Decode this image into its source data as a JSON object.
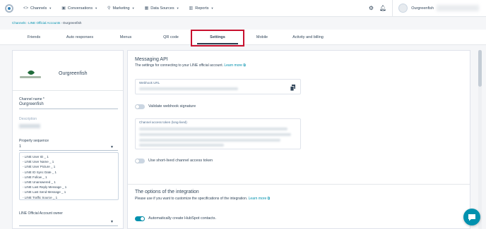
{
  "nav": {
    "items": [
      {
        "label": "Channels",
        "icon": "channels-icon"
      },
      {
        "label": "Conversations",
        "icon": "conversations-icon"
      },
      {
        "label": "Marketing",
        "icon": "marketing-icon"
      },
      {
        "label": "Data Sources",
        "icon": "data-sources-icon"
      },
      {
        "label": "Reports",
        "icon": "reports-icon"
      }
    ],
    "username": "Ourgreenfish"
  },
  "breadcrumb": {
    "items": [
      "Channels",
      "LINE Official Accounts"
    ],
    "current": "Ourgreenfish"
  },
  "tabs": [
    "Friends",
    "Auto responses",
    "Menus",
    "QR code",
    "Settings",
    "Mobile",
    "Activity and billing"
  ],
  "active_tab": "Settings",
  "profile": {
    "name": "Ourgreenfish",
    "channel_name_label": "Channel name *",
    "channel_name_value": "Ourgreenfish",
    "description_label": "Description",
    "property_sequence_label": "Property sequence",
    "property_sequence_value": "1",
    "sequence_items": [
      "- LINE User ID _ 1",
      "- LINE User Name _ 1",
      "- LINE User Picture _ 1",
      "- LINE ID Sync Date _ 1",
      "- LINE Follow _ 1",
      "- LINE Unanswered _ 1",
      "- LINE Last Reply Message _ 1",
      "- LINE Last Send Message _ 1",
      "- LINE Traffic Source _ 1"
    ],
    "owner_label": "LINE Official Account owner"
  },
  "messaging_api": {
    "title": "Messaging API",
    "description": "The settings for connecting to your LINE official account.",
    "learn_more": "Learn more",
    "webhook_label": "Webhook URL",
    "validate_label": "Validate webhook signature",
    "token_label": "Channel access token (long-lived)",
    "short_lived_label": "Use short-lived channel access token"
  },
  "integration": {
    "title": "The options of the integration",
    "description": "Please use if you want to customize the specifications of the integration.",
    "learn_more": "Learn more",
    "auto_create_label": "Automatically create HubSpot contacts."
  },
  "colors": {
    "accent": "#0091ae",
    "highlight": "#c8102e",
    "text": "#33475b"
  }
}
